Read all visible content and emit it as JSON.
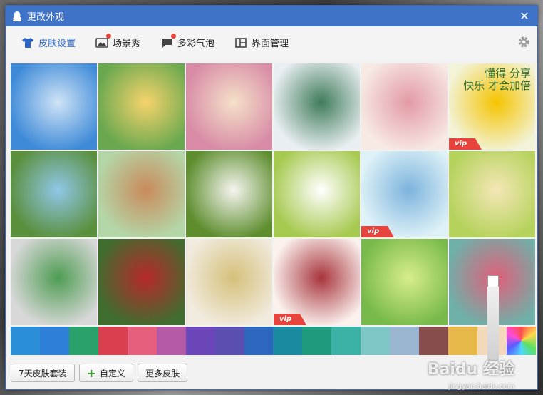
{
  "window": {
    "title": "更改外观",
    "close_glyph": "✕"
  },
  "tabs": [
    {
      "label": "皮肤设置",
      "icon": "shirt-icon",
      "active": true,
      "badge": false
    },
    {
      "label": "场景秀",
      "icon": "picture-icon",
      "active": false,
      "badge": true
    },
    {
      "label": "多彩气泡",
      "icon": "speech-bubble-icon",
      "active": false,
      "badge": true
    },
    {
      "label": "界面管理",
      "icon": "layout-icon",
      "active": false,
      "badge": false
    }
  ],
  "settings_icon": "gear-icon",
  "skins": [
    {
      "name": "sky-clouds",
      "colors": [
        "#3e8ad8",
        "#cfe3f6"
      ],
      "vip": false
    },
    {
      "name": "flower-shop",
      "colors": [
        "#6aa84f",
        "#f6d36b"
      ],
      "vip": false
    },
    {
      "name": "garden-arch",
      "colors": [
        "#d88aa6",
        "#f4e1c8"
      ],
      "vip": false
    },
    {
      "name": "white-cottage",
      "colors": [
        "#e9eef2",
        "#3f7c5a"
      ],
      "vip": false
    },
    {
      "name": "cherry-blossom",
      "colors": [
        "#f7e9e3",
        "#e39aa5"
      ],
      "vip": false
    },
    {
      "name": "yellow-daisies",
      "colors": [
        "#f2f3d9",
        "#f5c400"
      ],
      "vip": true,
      "caption": "懂得 分享\n快乐 才会加倍"
    },
    {
      "name": "park-bench",
      "colors": [
        "#5a8f3c",
        "#8fc7e8"
      ],
      "vip": false
    },
    {
      "name": "bicycle-field",
      "colors": [
        "#b4d7a8",
        "#c98a5b"
      ],
      "vip": false
    },
    {
      "name": "white-flower-green",
      "colors": [
        "#5d8d2d",
        "#f5f5f0"
      ],
      "vip": false
    },
    {
      "name": "cosmos-flower",
      "colors": [
        "#a6c94f",
        "#ffffff"
      ],
      "vip": false
    },
    {
      "name": "gingham-bow",
      "colors": [
        "#dff2f7",
        "#7cb3dd"
      ],
      "vip": true
    },
    {
      "name": "window-roses",
      "colors": [
        "#b5d25c",
        "#f4e7b6"
      ],
      "vip": false
    },
    {
      "name": "heart-leaf",
      "colors": [
        "#d8d8d8",
        "#4e9c52"
      ],
      "vip": false
    },
    {
      "name": "flower-mug",
      "colors": [
        "#3f6e2e",
        "#b8282a"
      ],
      "vip": false
    },
    {
      "name": "bird-branch",
      "colors": [
        "#f1ebdf",
        "#d5c07a"
      ],
      "vip": false
    },
    {
      "name": "butterfly",
      "colors": [
        "#fbf2ee",
        "#a8353d"
      ],
      "vip": true
    },
    {
      "name": "green-buds",
      "colors": [
        "#77b94a",
        "#d8ee8a"
      ],
      "vip": false
    },
    {
      "name": "pink-blossom-teal",
      "colors": [
        "#6fb0a8",
        "#e15f7a"
      ],
      "vip": false
    }
  ],
  "colors": [
    "#2a8fd7",
    "#2d7fd8",
    "#2aa06a",
    "#d8404f",
    "#e65f7d",
    "#b45aa6",
    "#6a46b8",
    "#5a4fb0",
    "#2d66bd",
    "#1a8aa0",
    "#1f9a7c",
    "#3bb0a4",
    "#7fc7c7",
    "#9ab6d0",
    "#874d4d",
    "#e6b84a",
    "#f3d9b9",
    "#ff7ad9"
  ],
  "footer": {
    "buttons": [
      {
        "label": "7天皮肤套装"
      },
      {
        "label": "自定义",
        "plus": "+"
      },
      {
        "label": "更多皮肤"
      }
    ]
  },
  "watermark": {
    "text": "Baidu 经验",
    "sub": "jingyan.baidu.com"
  }
}
